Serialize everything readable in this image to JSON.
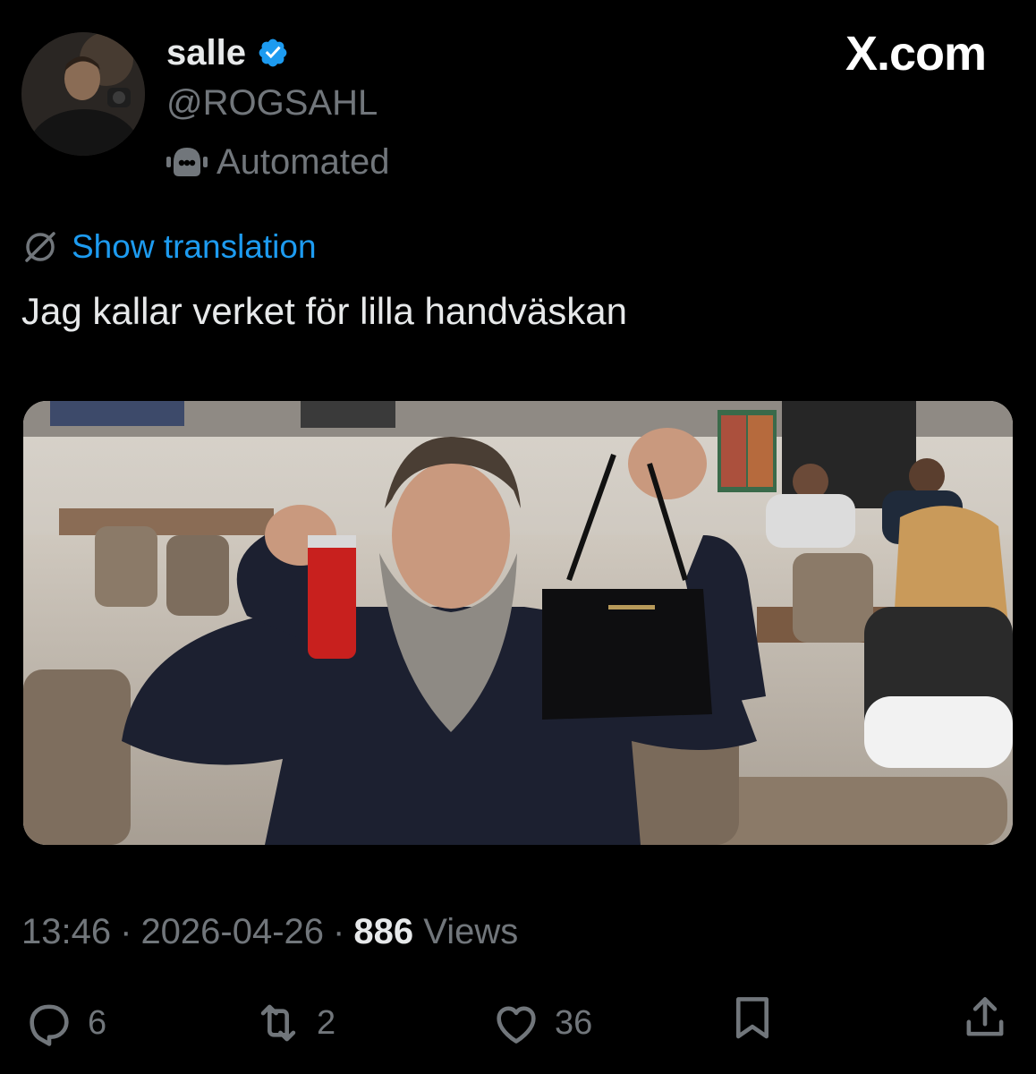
{
  "author": {
    "display_name": "salle",
    "handle": "@ROGSAHL",
    "automated_label": "Automated",
    "verified_color": "#1d9bf0"
  },
  "brand": {
    "label": "X.com"
  },
  "tweet": {
    "translate_label": "Show translation",
    "text": "Jag kallar verket för lilla handväskan"
  },
  "meta": {
    "time": "13:46",
    "separator": "·",
    "date": "2026-04-26",
    "views_count": "886",
    "views_label": "Views"
  },
  "actions": {
    "reply_count": "6",
    "repost_count": "2",
    "like_count": "36"
  },
  "icons": {
    "verified": "verified-badge-icon",
    "automated": "bot-icon",
    "translate": "globe-icon",
    "reply": "reply-icon",
    "repost": "repost-icon",
    "like": "heart-icon",
    "bookmark": "bookmark-icon",
    "share": "share-icon"
  },
  "colors": {
    "background": "#000000",
    "text": "#e7e9ea",
    "secondary": "#71767b",
    "link": "#1d9bf0"
  }
}
